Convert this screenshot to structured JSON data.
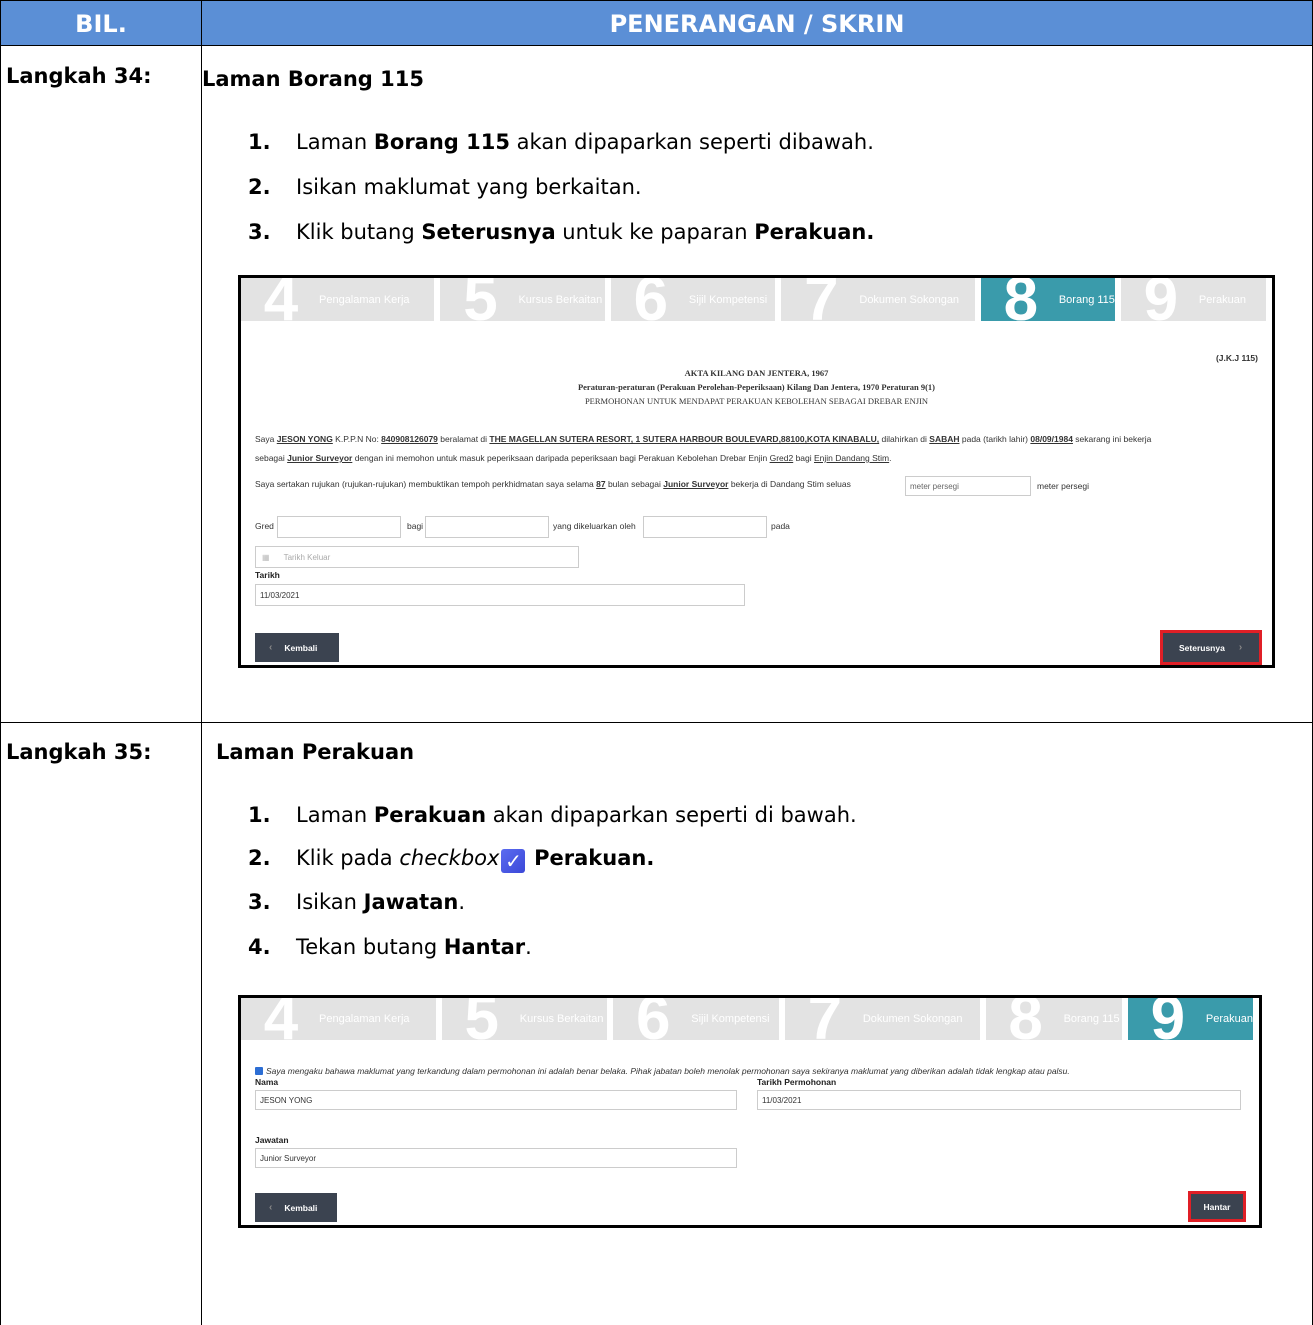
{
  "header": {
    "col1": "BIL.",
    "col2": "PENERANGAN / SKRIN"
  },
  "step34": {
    "label": "Langkah 34:",
    "title": "Laman Borang 115",
    "items": [
      {
        "n": "1.",
        "pre": "Laman ",
        "bold": "Borang 115",
        "post": " akan dipaparkan seperti dibawah."
      },
      {
        "n": "2.",
        "text": "Isikan maklumat yang berkaitan."
      },
      {
        "n": "3.",
        "pre": "Klik butang ",
        "bold": "Seterusnya",
        "mid": " untuk ke paparan ",
        "bold2": "Perakuan."
      }
    ],
    "screen": {
      "steps": [
        {
          "num": "4",
          "label": "Pengalaman Kerja"
        },
        {
          "num": "5",
          "label": "Kursus Berkaitan"
        },
        {
          "num": "6",
          "label": "Sijil Kompetensi"
        },
        {
          "num": "7",
          "label": "Dokumen Sokongan"
        },
        {
          "num": "8",
          "label": "Borang 115"
        },
        {
          "num": "9",
          "label": "Perakuan"
        }
      ],
      "ref": "(J.K.J 115)",
      "heading1": "AKTA KILANG DAN JENTERA, 1967",
      "heading2": "Peraturan-peraturan (Perakuan Perolehan-Peperiksaan) Kilang Dan Jentera, 1970 Peraturan 9(1)",
      "heading3": "PERMOHONAN UNTUK MENDAPAT PERAKUAN KEBOLEHAN SEBAGAI DREBAR ENJIN",
      "p1_a": "Saya ",
      "name": "JESON YONG",
      "p1_b": " K.P.P.N No: ",
      "ic": "840908126079",
      "p1_c": " beralamat di ",
      "address": "THE MAGELLAN SUTERA RESORT, 1 SUTERA HARBOUR BOULEVARD,88100,KOTA KINABALU,",
      "p1_d": " dilahirkan di ",
      "state": "SABAH",
      "p1_e": " pada (tarikh lahir) ",
      "dob": "08/09/1984",
      "p1_f": " sekarang ini bekerja",
      "p2_a": "sebagai ",
      "job": "Junior Surveyor",
      "p2_b": " dengan ini memohon untuk masuk peperiksaan daripada peperiksaan bagi Perakuan Kebolehan Drebar Enjin ",
      "grade": "Gred2",
      "p2_c": " bagi ",
      "engine": "Enjin Dandang Stim",
      "p2_d": ".",
      "p3_a": "Saya sertakan rujukan (rujukan-rujukan) membuktikan tempoh perkhidmatan saya selama ",
      "months": "87",
      "p3_b": " bulan sebagai ",
      "job2": "Junior Surveyor",
      "p3_c": " bekerja di Dandang Stim seluas",
      "area_placeholder": "meter persegi",
      "p3_d": "meter persegi",
      "gred": "Gred",
      "bagi": "bagi",
      "dikeluarkan": "yang dikeluarkan oleh",
      "pada": "pada",
      "tarikh_keluar": "Tarikh Keluar",
      "tarikh_label": "Tarikh",
      "tarikh_value": "11/03/2021",
      "back": "Kembali",
      "next": "Seterusnya"
    }
  },
  "step35": {
    "label": "Langkah 35:",
    "title": "Laman Perakuan",
    "items": [
      {
        "n": "1.",
        "pre": "Laman ",
        "bold": "Perakuan",
        "post": " akan dipaparkan seperti di bawah."
      },
      {
        "n": "2.",
        "pre": "Klik pada ",
        "ital": "checkbox",
        "bold": "Perakuan."
      },
      {
        "n": "3.",
        "pre": "Isikan ",
        "bold": "Jawatan",
        "post": "."
      },
      {
        "n": "4.",
        "pre": "Tekan butang ",
        "bold": "Hantar",
        "post": "."
      }
    ],
    "screen": {
      "declaration": "Saya mengaku bahawa maklumat yang terkandung dalam permohonan ini adalah benar belaka. Pihak jabatan boleh menolak permohonan saya sekiranya maklumat yang diberikan adalah tidak lengkap atau palsu.",
      "nama_label": "Nama",
      "nama_value": "JESON YONG",
      "tarikh_label": "Tarikh Permohonan",
      "tarikh_value": "11/03/2021",
      "jawatan_label": "Jawatan",
      "jawatan_value": "Junior Surveyor",
      "back": "Kembali",
      "submit": "Hantar"
    }
  }
}
